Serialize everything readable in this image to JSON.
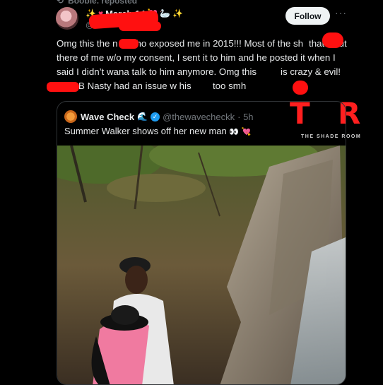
{
  "repost": {
    "label": "Boobie. reposted"
  },
  "author": {
    "display_name": "March 14",
    "handle_visible": "@"
  },
  "follow_label": "Follow",
  "more_label": "···",
  "post_text": "Omg this the n  a who exposed me in 2015!!! Most of the sh   that’s out there of me w/o my consent, I sent it to him and he posted it when I said I didn’t wana talk to him anymore. Omg this    is crazy & evil! Miss B Nasty had an issue w his   too smh",
  "watermark": {
    "letter_t": "T",
    "letter_r": "R",
    "caption": "THE SHADE ROOM"
  },
  "quote": {
    "name": "Wave Check",
    "handle": "@thewavecheckk",
    "time": "· 5h",
    "text": "Summer Walker shows off her new man",
    "eyes": "👀",
    "heart": "💘"
  },
  "colors": {
    "background": "#000000",
    "text": "#e7e9ea",
    "muted": "#71767b",
    "accent": "#1d9bf0",
    "redaction": "#ff1010"
  }
}
